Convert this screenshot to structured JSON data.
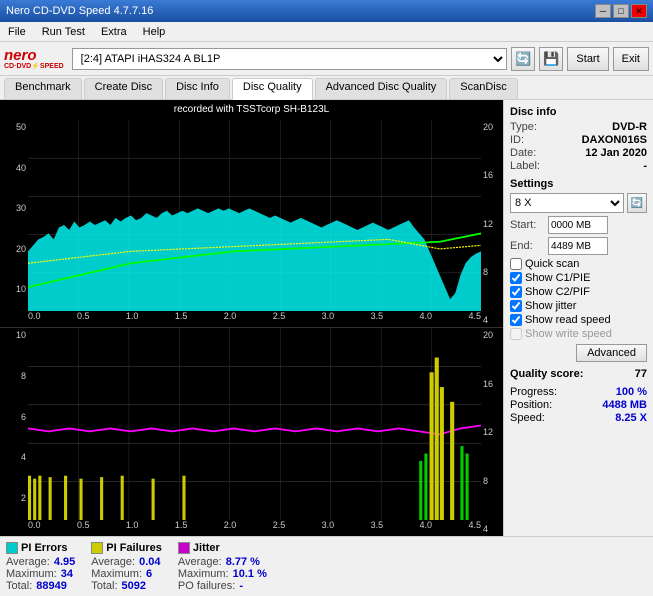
{
  "titleBar": {
    "title": "Nero CD-DVD Speed 4.7.7.16",
    "minBtn": "─",
    "maxBtn": "□",
    "closeBtn": "✕"
  },
  "menuBar": {
    "items": [
      "File",
      "Run Test",
      "Extra",
      "Help"
    ]
  },
  "toolbar": {
    "driveLabel": "[2:4]  ATAPI iHAS324  A BL1P",
    "startBtn": "Start",
    "exitBtn": "Exit"
  },
  "tabs": {
    "items": [
      "Benchmark",
      "Create Disc",
      "Disc Info",
      "Disc Quality",
      "Advanced Disc Quality",
      "ScanDisc"
    ],
    "active": "Disc Quality"
  },
  "chart": {
    "title": "recorded with TSSTcorp SH-B123L",
    "topYLeft": [
      "50",
      "40",
      "30",
      "20",
      "10"
    ],
    "topYRight": [
      "20",
      "16",
      "12",
      "8",
      "4"
    ],
    "bottomYLeft": [
      "10",
      "8",
      "6",
      "4",
      "2"
    ],
    "bottomYRight": [
      "20",
      "16",
      "12",
      "8",
      "4"
    ],
    "xLabels": [
      "0.0",
      "0.5",
      "1.0",
      "1.5",
      "2.0",
      "2.5",
      "3.0",
      "3.5",
      "4.0",
      "4.5"
    ]
  },
  "sidebar": {
    "discInfoTitle": "Disc info",
    "typeLabel": "Type:",
    "typeValue": "DVD-R",
    "idLabel": "ID:",
    "idValue": "DAXON016S",
    "dateLabel": "Date:",
    "dateValue": "12 Jan 2020",
    "labelLabel": "Label:",
    "labelValue": "-",
    "settingsTitle": "Settings",
    "speedValue": "8 X",
    "startLabel": "Start:",
    "startValue": "0000 MB",
    "endLabel": "End:",
    "endValue": "4489 MB",
    "quickScanLabel": "Quick scan",
    "showC1PIELabel": "Show C1/PIE",
    "showC2PIFLabel": "Show C2/PIF",
    "showJitterLabel": "Show jitter",
    "showReadSpeedLabel": "Show read speed",
    "showWriteSpeedLabel": "Show write speed",
    "advancedBtn": "Advanced",
    "qualityScoreLabel": "Quality score:",
    "qualityScoreValue": "77",
    "progressLabel": "Progress:",
    "progressValue": "100 %",
    "positionLabel": "Position:",
    "positionValue": "4488 MB",
    "speedLabel": "Speed:",
    "speedReadValue": "8.25 X"
  },
  "stats": {
    "piErrors": {
      "label": "PI Errors",
      "color": "#00cccc",
      "avgLabel": "Average:",
      "avgValue": "4.95",
      "maxLabel": "Maximum:",
      "maxValue": "34",
      "totalLabel": "Total:",
      "totalValue": "88949"
    },
    "piFailures": {
      "label": "PI Failures",
      "color": "#cccc00",
      "avgLabel": "Average:",
      "avgValue": "0.04",
      "maxLabel": "Maximum:",
      "maxValue": "6",
      "totalLabel": "Total:",
      "totalValue": "5092"
    },
    "jitter": {
      "label": "Jitter",
      "color": "#cc00cc",
      "avgLabel": "Average:",
      "avgValue": "8.77 %",
      "maxLabel": "Maximum:",
      "maxValue": "10.1 %",
      "poLabel": "PO failures:",
      "poValue": "-"
    }
  }
}
